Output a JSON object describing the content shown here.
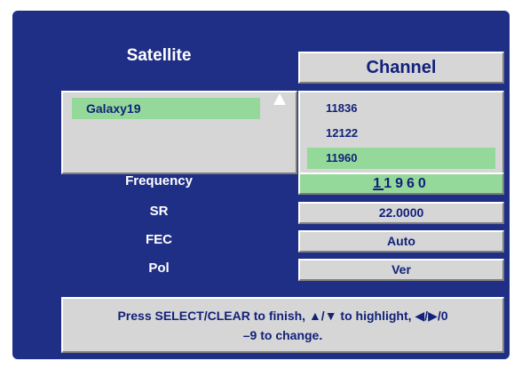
{
  "satellite": {
    "title": "Satellite",
    "items": [
      {
        "label": "Galaxy19",
        "highlighted": true
      }
    ]
  },
  "channel": {
    "title": "Channel",
    "items": [
      {
        "label": "11836",
        "highlighted": false
      },
      {
        "label": "12122",
        "highlighted": false
      },
      {
        "label": "11960",
        "highlighted": true
      }
    ]
  },
  "fields": {
    "frequency": {
      "label": "Frequency",
      "cursor_digit": "1",
      "rest": "1960"
    },
    "sr": {
      "label": "SR",
      "value": "22.0000"
    },
    "fec": {
      "label": "FEC",
      "value": "Auto"
    },
    "pol": {
      "label": "Pol",
      "value": "Ver"
    }
  },
  "help": {
    "line1": "Press SELECT/CLEAR to finish, ▲/▼ to highlight, ◀/▶/0",
    "line2": "–9 to change."
  },
  "colors": {
    "background": "#1f2f86",
    "panel": "#d6d6d6",
    "highlight": "#95d99a",
    "text": "#12217a"
  },
  "icons": {
    "scroll_up": "triangle-up-icon"
  }
}
